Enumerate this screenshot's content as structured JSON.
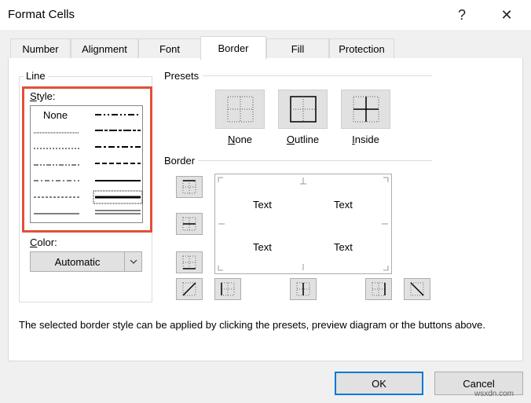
{
  "window": {
    "title": "Format Cells",
    "help_label": "?",
    "close_label": "✕"
  },
  "tabs": [
    {
      "label": "Number"
    },
    {
      "label": "Alignment"
    },
    {
      "label": "Font"
    },
    {
      "label": "Border",
      "active": true
    },
    {
      "label": "Fill"
    },
    {
      "label": "Protection"
    }
  ],
  "line": {
    "group_label": "Line",
    "style_label": "Style:",
    "style_label_mnemonic": "S",
    "style_label_rest": "tyle:",
    "styles_col1": [
      "None",
      "hair",
      "dotted",
      "dash-dot-dot",
      "dash-dot",
      "dashed",
      "thin"
    ],
    "styles_col2": [
      "medium-dash-dot-dot",
      "slanted-dash-dot",
      "medium-dash-dot",
      "medium-dashed",
      "medium",
      "thick",
      "double"
    ],
    "selected_style": "thick",
    "color_label": "Color:",
    "color_label_mnemonic": "C",
    "color_label_rest": "olor:",
    "color_value": "Automatic"
  },
  "presets": {
    "group_label": "Presets",
    "items": [
      {
        "label": "None",
        "mnemonic": "N",
        "rest": "one"
      },
      {
        "label": "Outline",
        "mnemonic": "O",
        "rest": "utline"
      },
      {
        "label": "Inside",
        "mnemonic": "I",
        "rest": "nside"
      }
    ]
  },
  "border": {
    "group_label": "Border",
    "preview_text": [
      "Text",
      "Text",
      "Text",
      "Text"
    ]
  },
  "hint_text": "The selected border style can be applied by clicking the presets, preview diagram or the buttons above.",
  "buttons": {
    "ok": "OK",
    "cancel": "Cancel"
  },
  "watermark": "wsxdn.com",
  "colors": {
    "highlight": "#e0503a",
    "focus_border": "#0078d7"
  }
}
